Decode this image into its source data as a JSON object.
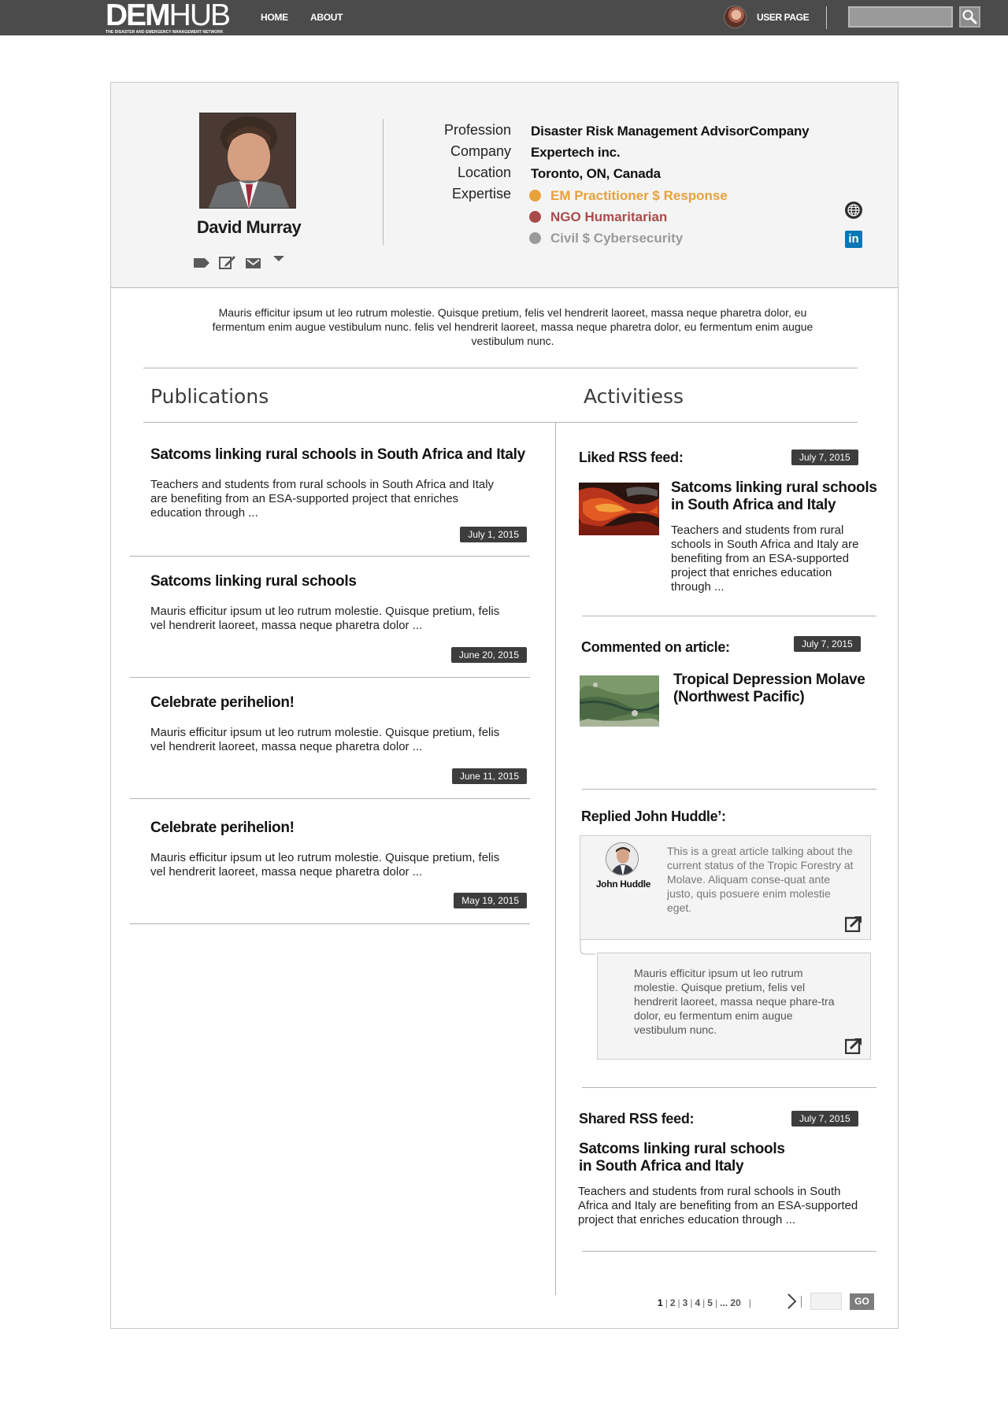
{
  "header": {
    "logo_bold": "DEM",
    "logo_thin": "HUB",
    "logo_tagline": "THE DISASTER AND EMERGENCY MANAGEMENT NETWORK",
    "nav": {
      "home": "HOME",
      "about": "ABOUT"
    },
    "user_page": "USER PAGE",
    "search": {
      "value": "",
      "placeholder": ""
    }
  },
  "profile": {
    "name": "David Murray",
    "fields": {
      "profession_label": "Profession",
      "profession": "Disaster Risk Management AdvisorCompany",
      "company_label": "Company",
      "company": "Expertech inc.",
      "location_label": "Location",
      "location": "Toronto, ON, Canada",
      "expertise_label": "Expertise"
    },
    "expertise": [
      {
        "label": "EM Practitioner $ Response",
        "color": "#e8a13a"
      },
      {
        "label": "NGO Humaritarian",
        "color": "#a94b4b"
      },
      {
        "label": "Civil $ Cybersecurity",
        "color": "#9a9a9a"
      }
    ],
    "linkedin_glyph": "in"
  },
  "bio": "Mauris efficitur ipsum ut leo rutrum molestie. Quisque pretium, felis vel hendrerit laoreet, massa neque pharetra dolor, eu fermentum enim augue vestibulum nunc. felis vel hendrerit laoreet, massa neque pharetra dolor, eu fermentum enim augue vestibulum nunc.",
  "publications": {
    "heading": "Publications",
    "items": [
      {
        "title": "Satcoms linking rural schools in South Africa and Italy",
        "body": "Teachers and students from rural schools in South Africa and Italy are benefiting from an ESA-supported project that enriches education through ...",
        "date": "July 1, 2015"
      },
      {
        "title": "Satcoms linking rural schools",
        "body": "Mauris efficitur ipsum ut leo rutrum molestie. Quisque pretium, felis vel hendrerit laoreet, massa neque pharetra dolor ...",
        "date": "June 20, 2015"
      },
      {
        "title": "Celebrate perihelion!",
        "body": "Mauris efficitur ipsum ut leo rutrum molestie. Quisque pretium, felis vel hendrerit laoreet, massa neque pharetra dolor ...",
        "date": "June 11, 2015"
      },
      {
        "title": "Celebrate perihelion!",
        "body": "Mauris efficitur ipsum ut leo rutrum molestie. Quisque pretium, felis vel hendrerit laoreet, massa neque pharetra dolor ...",
        "date": "May 19, 2015"
      }
    ]
  },
  "activities": {
    "heading": "Activitiess",
    "liked": {
      "label": "Liked RSS feed:",
      "date": "July 7, 2015",
      "title": "Satcoms linking rural schools in South Africa and Italy",
      "body": "Teachers and students from rural schools in South Africa and Italy are benefiting from an ESA-supported project that enriches education through ..."
    },
    "commented": {
      "label": "Commented on article:",
      "date": "July 7, 2015",
      "title": "Tropical Depression Molave (Northwest Pacific)"
    },
    "replied": {
      "label": "Replied John Huddle’:",
      "author": "John Huddle",
      "comment": "This is a great article talking about the current status of the Tropic Forestry at Molave. Aliquam conse-quat ante justo, quis posuere enim molestie eget.",
      "reply": "Mauris efficitur ipsum ut leo rutrum molestie. Quisque pretium, felis vel hendrerit laoreet, massa neque phare-tra dolor, eu fermentum enim augue vestibulum nunc."
    },
    "shared": {
      "label": "Shared RSS feed:",
      "date": "July 7, 2015",
      "title": "Satcoms linking rural schools in South Africa and Italy",
      "body": "Teachers and students from rural schools in South Africa and Italy are benefiting from an ESA-supported project that enriches education through ..."
    }
  },
  "pagination": {
    "pages": [
      "1",
      "2",
      "3",
      "4",
      "5",
      "... 20"
    ],
    "current": "1",
    "input_value": "",
    "go_label": "GO"
  }
}
